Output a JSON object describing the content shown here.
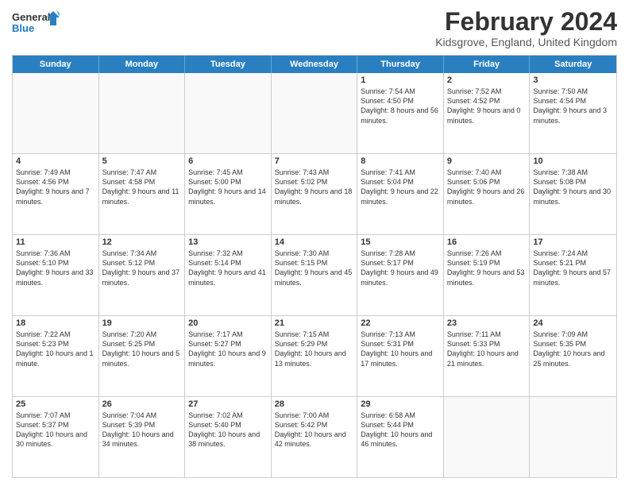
{
  "header": {
    "logo_general": "General",
    "logo_blue": "Blue",
    "month_title": "February 2024",
    "location": "Kidsgrove, England, United Kingdom"
  },
  "days_of_week": [
    "Sunday",
    "Monday",
    "Tuesday",
    "Wednesday",
    "Thursday",
    "Friday",
    "Saturday"
  ],
  "weeks": [
    [
      {
        "day": "",
        "info": ""
      },
      {
        "day": "",
        "info": ""
      },
      {
        "day": "",
        "info": ""
      },
      {
        "day": "",
        "info": ""
      },
      {
        "day": "1",
        "info": "Sunrise: 7:54 AM\nSunset: 4:50 PM\nDaylight: 8 hours and 56 minutes."
      },
      {
        "day": "2",
        "info": "Sunrise: 7:52 AM\nSunset: 4:52 PM\nDaylight: 9 hours and 0 minutes."
      },
      {
        "day": "3",
        "info": "Sunrise: 7:50 AM\nSunset: 4:54 PM\nDaylight: 9 hours and 3 minutes."
      }
    ],
    [
      {
        "day": "4",
        "info": "Sunrise: 7:49 AM\nSunset: 4:56 PM\nDaylight: 9 hours and 7 minutes."
      },
      {
        "day": "5",
        "info": "Sunrise: 7:47 AM\nSunset: 4:58 PM\nDaylight: 9 hours and 11 minutes."
      },
      {
        "day": "6",
        "info": "Sunrise: 7:45 AM\nSunset: 5:00 PM\nDaylight: 9 hours and 14 minutes."
      },
      {
        "day": "7",
        "info": "Sunrise: 7:43 AM\nSunset: 5:02 PM\nDaylight: 9 hours and 18 minutes."
      },
      {
        "day": "8",
        "info": "Sunrise: 7:41 AM\nSunset: 5:04 PM\nDaylight: 9 hours and 22 minutes."
      },
      {
        "day": "9",
        "info": "Sunrise: 7:40 AM\nSunset: 5:06 PM\nDaylight: 9 hours and 26 minutes."
      },
      {
        "day": "10",
        "info": "Sunrise: 7:38 AM\nSunset: 5:08 PM\nDaylight: 9 hours and 30 minutes."
      }
    ],
    [
      {
        "day": "11",
        "info": "Sunrise: 7:36 AM\nSunset: 5:10 PM\nDaylight: 9 hours and 33 minutes."
      },
      {
        "day": "12",
        "info": "Sunrise: 7:34 AM\nSunset: 5:12 PM\nDaylight: 9 hours and 37 minutes."
      },
      {
        "day": "13",
        "info": "Sunrise: 7:32 AM\nSunset: 5:14 PM\nDaylight: 9 hours and 41 minutes."
      },
      {
        "day": "14",
        "info": "Sunrise: 7:30 AM\nSunset: 5:15 PM\nDaylight: 9 hours and 45 minutes."
      },
      {
        "day": "15",
        "info": "Sunrise: 7:28 AM\nSunset: 5:17 PM\nDaylight: 9 hours and 49 minutes."
      },
      {
        "day": "16",
        "info": "Sunrise: 7:26 AM\nSunset: 5:19 PM\nDaylight: 9 hours and 53 minutes."
      },
      {
        "day": "17",
        "info": "Sunrise: 7:24 AM\nSunset: 5:21 PM\nDaylight: 9 hours and 57 minutes."
      }
    ],
    [
      {
        "day": "18",
        "info": "Sunrise: 7:22 AM\nSunset: 5:23 PM\nDaylight: 10 hours and 1 minute."
      },
      {
        "day": "19",
        "info": "Sunrise: 7:20 AM\nSunset: 5:25 PM\nDaylight: 10 hours and 5 minutes."
      },
      {
        "day": "20",
        "info": "Sunrise: 7:17 AM\nSunset: 5:27 PM\nDaylight: 10 hours and 9 minutes."
      },
      {
        "day": "21",
        "info": "Sunrise: 7:15 AM\nSunset: 5:29 PM\nDaylight: 10 hours and 13 minutes."
      },
      {
        "day": "22",
        "info": "Sunrise: 7:13 AM\nSunset: 5:31 PM\nDaylight: 10 hours and 17 minutes."
      },
      {
        "day": "23",
        "info": "Sunrise: 7:11 AM\nSunset: 5:33 PM\nDaylight: 10 hours and 21 minutes."
      },
      {
        "day": "24",
        "info": "Sunrise: 7:09 AM\nSunset: 5:35 PM\nDaylight: 10 hours and 25 minutes."
      }
    ],
    [
      {
        "day": "25",
        "info": "Sunrise: 7:07 AM\nSunset: 5:37 PM\nDaylight: 10 hours and 30 minutes."
      },
      {
        "day": "26",
        "info": "Sunrise: 7:04 AM\nSunset: 5:39 PM\nDaylight: 10 hours and 34 minutes."
      },
      {
        "day": "27",
        "info": "Sunrise: 7:02 AM\nSunset: 5:40 PM\nDaylight: 10 hours and 38 minutes."
      },
      {
        "day": "28",
        "info": "Sunrise: 7:00 AM\nSunset: 5:42 PM\nDaylight: 10 hours and 42 minutes."
      },
      {
        "day": "29",
        "info": "Sunrise: 6:58 AM\nSunset: 5:44 PM\nDaylight: 10 hours and 46 minutes."
      },
      {
        "day": "",
        "info": ""
      },
      {
        "day": "",
        "info": ""
      }
    ]
  ]
}
